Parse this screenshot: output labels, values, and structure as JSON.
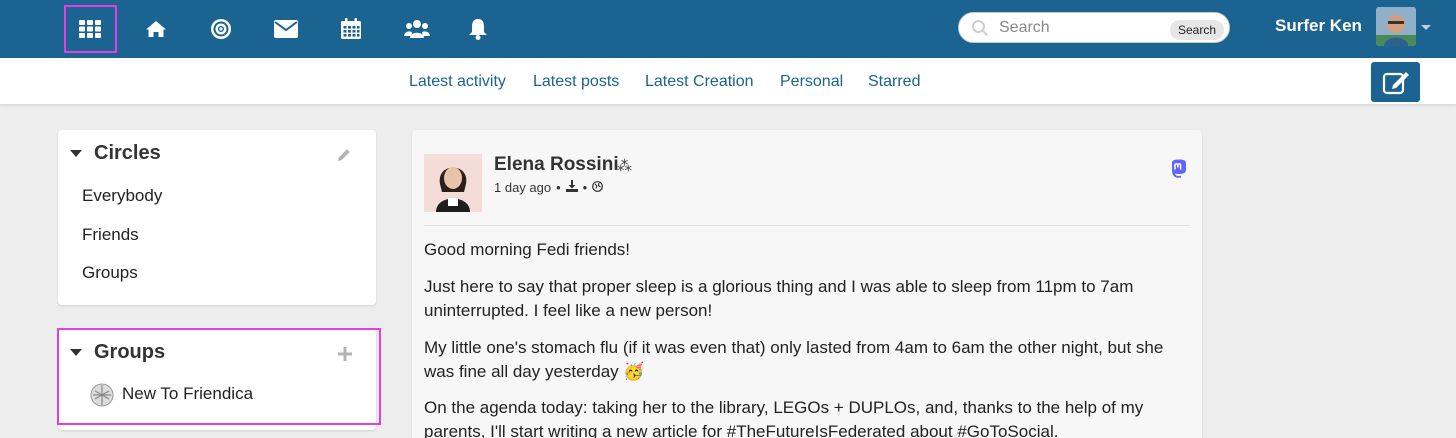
{
  "topnav": {
    "icons": [
      "apps-grid-icon",
      "home-icon",
      "network-icon",
      "messages-icon",
      "calendar-icon",
      "contacts-icon",
      "notifications-icon"
    ],
    "search": {
      "placeholder": "Search",
      "button_label": "Search"
    },
    "user": {
      "name": "Surfer Ken"
    }
  },
  "subnav": {
    "tabs": [
      {
        "label": "Latest activity"
      },
      {
        "label": "Latest posts"
      },
      {
        "label": "Latest Creation"
      },
      {
        "label": "Personal"
      },
      {
        "label": "Starred"
      }
    ],
    "compose_icon": "compose-icon"
  },
  "sidebar": {
    "circles": {
      "title": "Circles",
      "items": [
        {
          "label": "Everybody"
        },
        {
          "label": "Friends"
        },
        {
          "label": "Groups"
        }
      ]
    },
    "groups": {
      "title": "Groups",
      "items": [
        {
          "label": "New To Friendica"
        }
      ]
    }
  },
  "post": {
    "author": "Elena Rossini",
    "author_badge": "⁂",
    "time": "1 day ago",
    "network_icon": "mastodon-icon",
    "paragraphs": [
      "Good morning Fedi friends!",
      "Just here to say that proper sleep is a glorious thing and I was able to sleep from 11pm to 7am uninterrupted. I feel like a new person!",
      "My little one's stomach flu (if it was even that) only lasted from 4am to 6am the other night, but she was fine all day yesterday 🥳",
      "On the agenda today: taking her to the library, LEGOs + DUPLOs, and, thanks to the help of my parents, I'll start writing a new article for #TheFutureIsFederated about #GoToSocial."
    ]
  },
  "colors": {
    "brand": "#1b6391",
    "highlight": "#e23ee2",
    "background": "#ededed"
  }
}
